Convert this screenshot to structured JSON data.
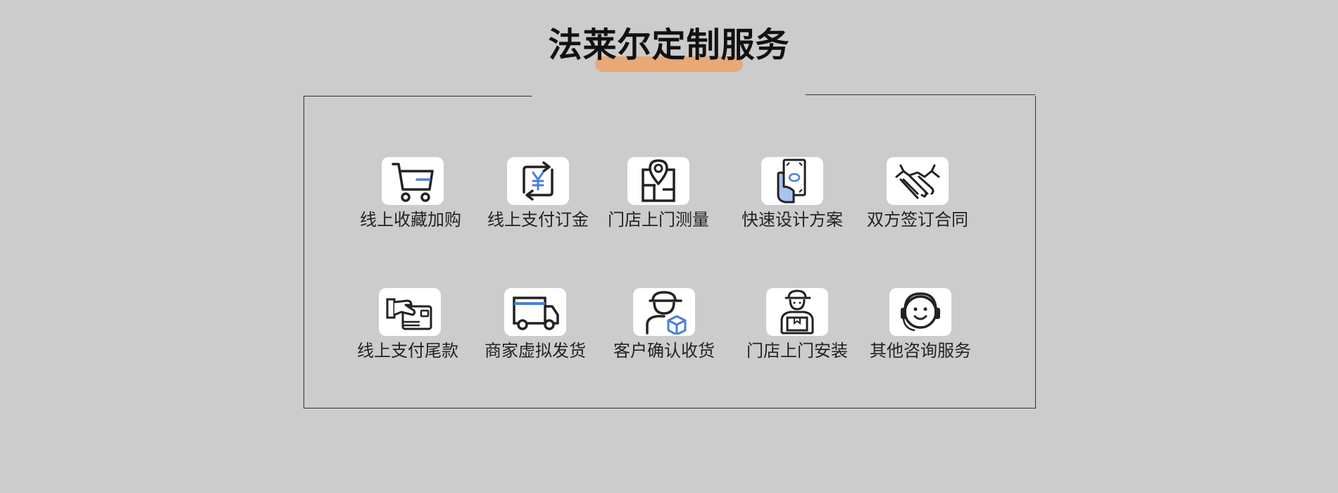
{
  "title": "法莱尔定制服务",
  "colors": {
    "background": "#cccccc",
    "highlight": "#e8a878",
    "icon_accent": "#4a7fd8",
    "icon_stroke": "#222222"
  },
  "steps_row1": [
    {
      "label": "线上收藏加购",
      "icon": "shopping-cart-icon"
    },
    {
      "label": "线上支付订金",
      "icon": "yuan-exchange-icon"
    },
    {
      "label": "门店上门测量",
      "icon": "map-pin-icon"
    },
    {
      "label": "快速设计方案",
      "icon": "hand-cash-icon"
    },
    {
      "label": "双方签订合同",
      "icon": "handshake-icon"
    }
  ],
  "steps_row2": [
    {
      "label": "线上支付尾款",
      "icon": "card-payment-icon"
    },
    {
      "label": "商家虚拟发货",
      "icon": "delivery-truck-icon"
    },
    {
      "label": "客户确认收货",
      "icon": "courier-package-icon"
    },
    {
      "label": "门店上门安装",
      "icon": "installer-worker-icon"
    },
    {
      "label": "其他咨询服务",
      "icon": "customer-service-icon"
    }
  ]
}
